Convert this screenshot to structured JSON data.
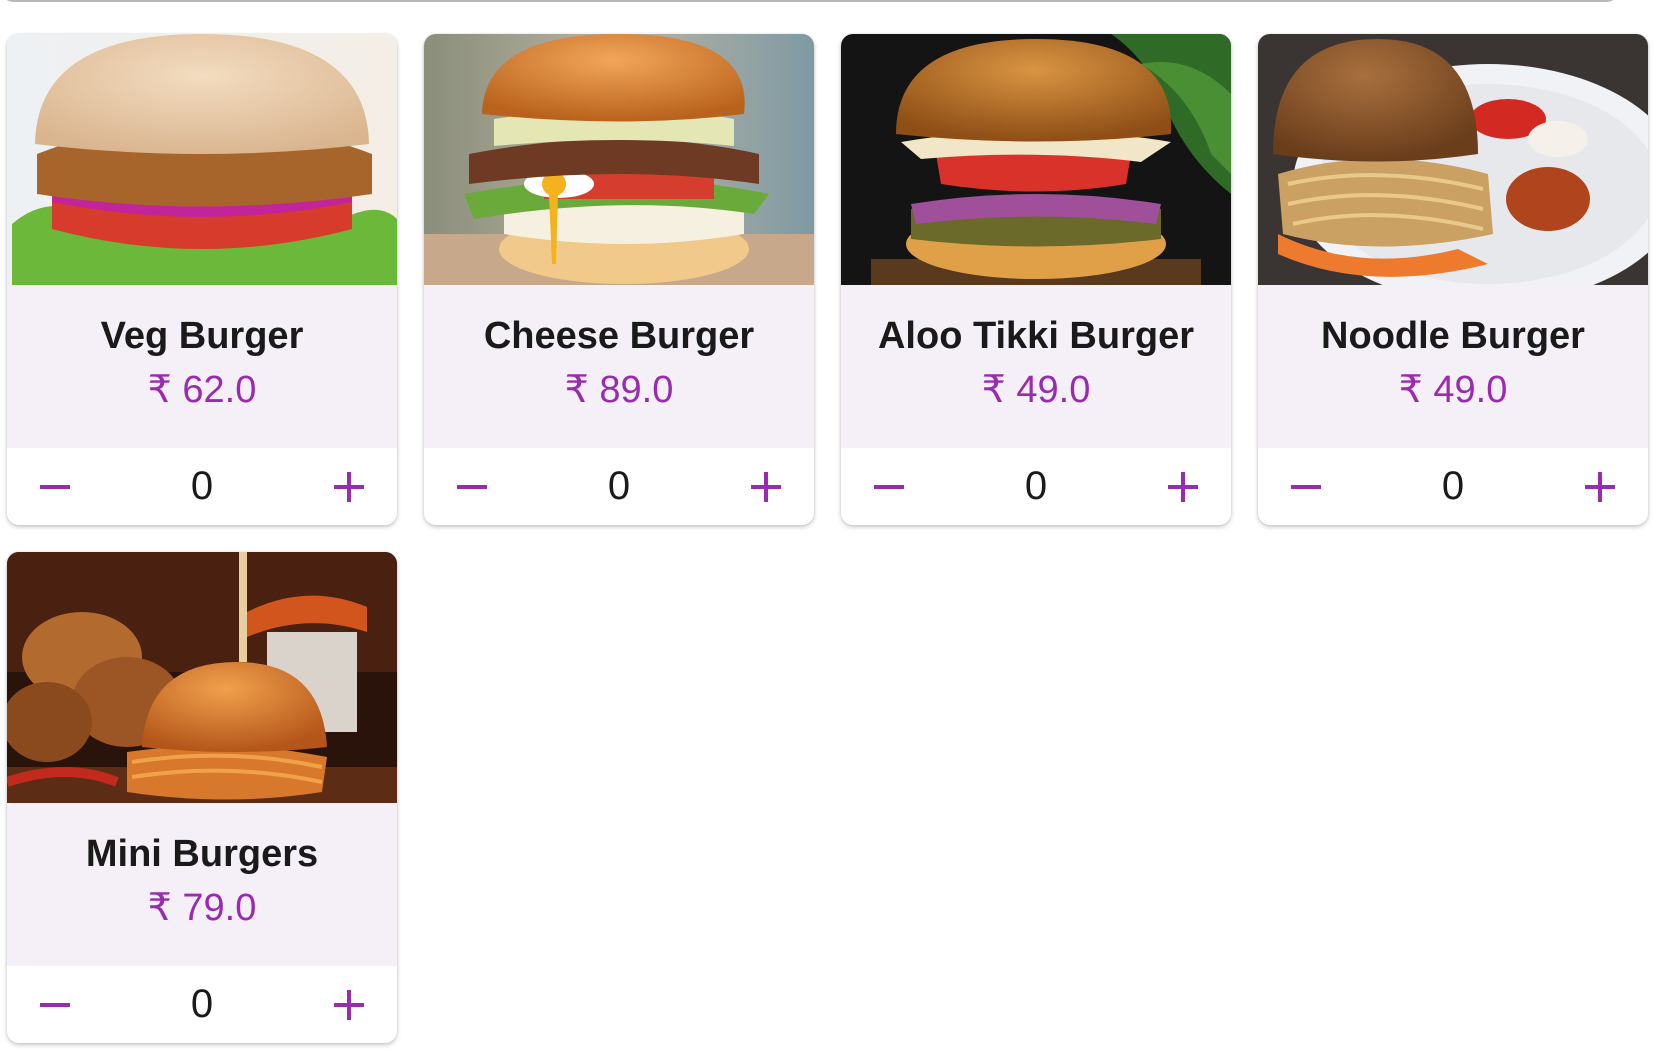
{
  "colors": {
    "accent": "#9a2ab0",
    "card_info_bg": "#f5eff8"
  },
  "products": [
    {
      "name": "Veg Burger",
      "price": "₹ 62.0",
      "quantity": "0",
      "image": "veg-burger-photo"
    },
    {
      "name": "Cheese Burger",
      "price": "₹ 89.0",
      "quantity": "0",
      "image": "cheese-burger-photo"
    },
    {
      "name": "Aloo Tikki Burger",
      "price": "₹ 49.0",
      "quantity": "0",
      "image": "aloo-tikki-burger-photo"
    },
    {
      "name": "Noodle Burger",
      "price": "₹ 49.0",
      "quantity": "0",
      "image": "noodle-burger-photo"
    },
    {
      "name": "Mini Burgers",
      "price": "₹ 79.0",
      "quantity": "0",
      "image": "mini-burgers-photo"
    }
  ],
  "icons": {
    "decrement": "minus-icon",
    "increment": "plus-icon"
  }
}
